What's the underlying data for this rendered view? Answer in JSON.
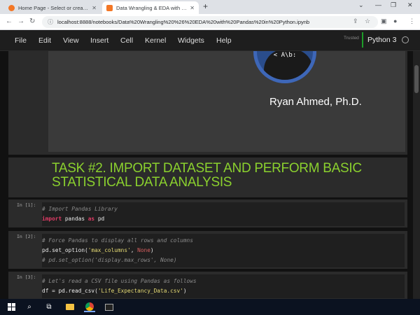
{
  "browser": {
    "tabs": [
      {
        "title": "Home Page - Select or create a n",
        "active": false
      },
      {
        "title": "Data Wrangling & EDA with Pand",
        "active": true
      }
    ],
    "url": "localhost:8888/notebooks/Data%20Wrangling%20%26%20EDA%20with%20Pandas%20in%20Python.ipynb"
  },
  "menubar": {
    "items": [
      "File",
      "Edit",
      "View",
      "Insert",
      "Cell",
      "Kernel",
      "Widgets",
      "Help"
    ],
    "trusted": "Trusted",
    "kernel": "Python 3"
  },
  "header_cell": {
    "slogan": "< A\\b:",
    "author": "Ryan Ahmed, Ph.D."
  },
  "task_cell": {
    "title": "TASK #2. IMPORT DATASET AND PERFORM BASIC STATISTICAL DATA ANALYSIS"
  },
  "code_cells": [
    {
      "prompt": "In [1]:",
      "lines": [
        "# Import Pandas Library",
        "import pandas as pd"
      ]
    },
    {
      "prompt": "In [2]:",
      "lines": [
        "# Force Pandas to display all rows and columns",
        "pd.set_option('max_columns', None)",
        "# pd.set_option('display.max_rows', None)"
      ]
    },
    {
      "prompt": "In [3]:",
      "lines": [
        "# Let's read a CSV file using Pandas as follows",
        "df = pd.read_csv('Life_Expectancy_Data.csv')"
      ]
    }
  ],
  "colors": {
    "accent_green": "#8bd12e",
    "kernel_green": "#1d9c28",
    "keyword": "#e03c66"
  }
}
